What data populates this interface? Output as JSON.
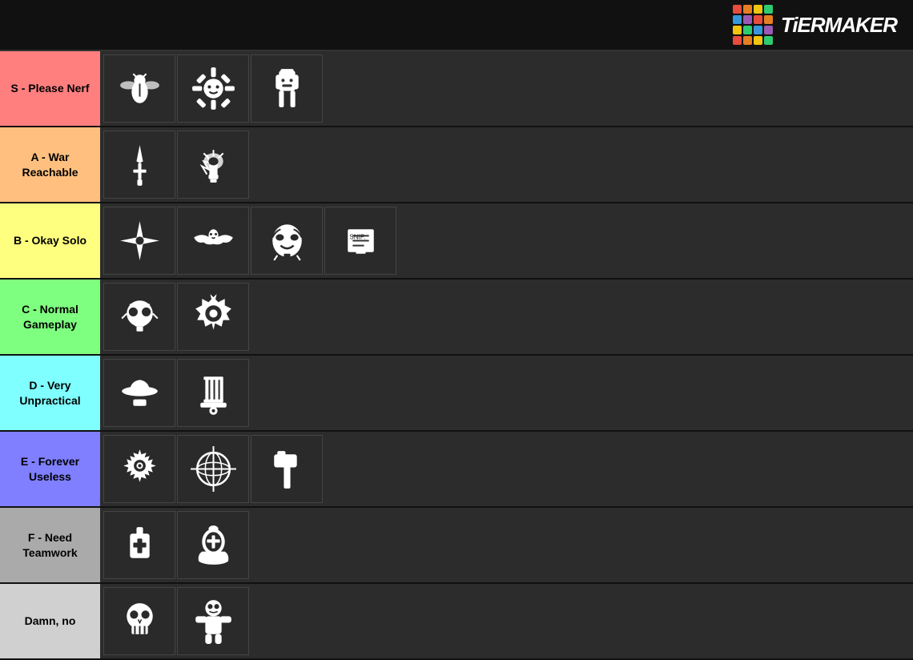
{
  "header": {
    "logo_text": "TiERMAKER",
    "logo_colors": [
      "#e74c3c",
      "#e67e22",
      "#f1c40f",
      "#2ecc71",
      "#3498db",
      "#9b59b6",
      "#e74c3c",
      "#e67e22",
      "#f1c40f",
      "#2ecc71",
      "#3498db",
      "#9b59b6",
      "#e74c3c",
      "#e67e22",
      "#f1c40f",
      "#2ecc71"
    ]
  },
  "tiers": [
    {
      "id": "s",
      "label": "S - Please Nerf",
      "color": "#ff7f7f",
      "items": 3
    },
    {
      "id": "a",
      "label": "A - War Reachable",
      "color": "#ffbf7f",
      "items": 2
    },
    {
      "id": "b",
      "label": "B - Okay Solo",
      "color": "#ffff7f",
      "items": 4
    },
    {
      "id": "c",
      "label": "C - Normal Gameplay",
      "color": "#7fff7f",
      "items": 2
    },
    {
      "id": "d",
      "label": "D - Very Unpractical",
      "color": "#7fffff",
      "items": 2
    },
    {
      "id": "e",
      "label": "E - Forever Useless",
      "color": "#7f7fff",
      "items": 3
    },
    {
      "id": "f",
      "label": "F - Need Teamwork",
      "color": "#aaaaaa",
      "items": 2
    },
    {
      "id": "damn",
      "label": "Damn, no",
      "color": "#d0d0d0",
      "items": 2
    }
  ]
}
